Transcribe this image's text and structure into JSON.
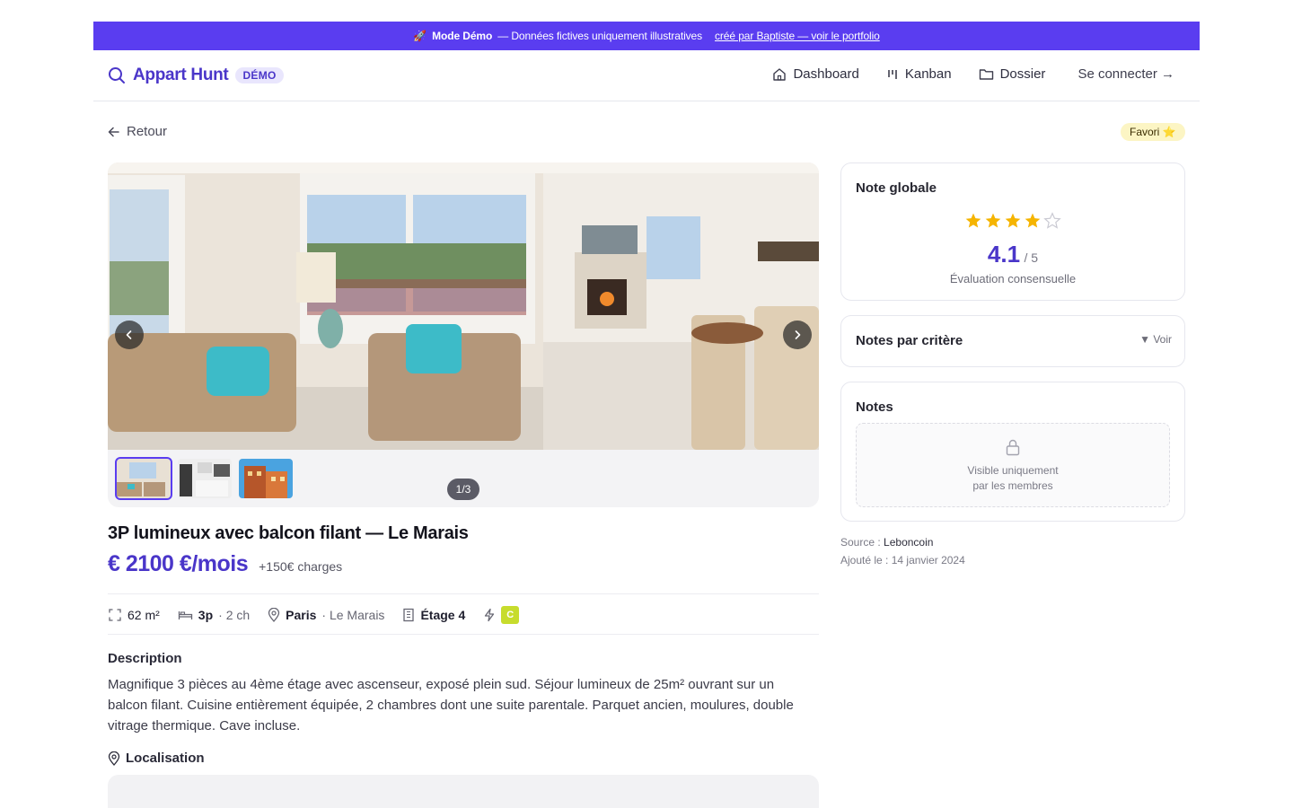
{
  "banner": {
    "icon": "rocket-icon",
    "mode_label": "Mode Démo",
    "text": "— Données fictives uniquement illustratives",
    "link": "créé par Baptiste — voir le portfolio"
  },
  "nav": {
    "brand": "Appart Hunt",
    "badge": "DÉMO",
    "links": [
      {
        "label": "Dashboard",
        "icon": "home-icon"
      },
      {
        "label": "Kanban",
        "icon": "kanban-icon"
      },
      {
        "label": "Dossier",
        "icon": "folder-icon"
      }
    ],
    "login": "Se connecter →"
  },
  "page": {
    "back": "Retour",
    "favorite": "Favori ⭐"
  },
  "gallery": {
    "counter": "1/3",
    "thumbnails": [
      "living-room",
      "kitchen",
      "building-facade"
    ]
  },
  "listing": {
    "title": "3P lumineux avec balcon filant — Le Marais",
    "price": "€ 2100 €/mois",
    "charges": "+150€ charges",
    "surface": "62 m²",
    "rooms": "3p",
    "bedrooms": "· 2 ch",
    "city": "Paris",
    "district": "· Le Marais",
    "floor": "Étage 4",
    "dpe": "C",
    "description_title": "Description",
    "description": "Magnifique 3 pièces au 4ème étage avec ascenseur, exposé plein sud. Séjour lumineux de 25m² ouvrant sur un balcon filant. Cuisine entièrement équipée, 2 chambres dont une suite parentale. Parquet ancien, moulures, double vitrage thermique. Cave incluse.",
    "location_title": "Localisation"
  },
  "rating": {
    "title": "Note globale",
    "value": "4.1",
    "out_of": "/ 5",
    "stars_filled": 4,
    "stars_total": 5,
    "caption": "Évaluation consensuelle"
  },
  "criteria": {
    "title": "Notes par critère",
    "toggle": "▼ Voir"
  },
  "notes": {
    "title": "Notes",
    "locked_line1": "Visible uniquement",
    "locked_line2": "par les membres"
  },
  "meta": {
    "source_label": "Source :",
    "source_value": "Leboncoin",
    "added_label": "Ajouté le :",
    "added_value": "14 janvier 2024"
  },
  "colors": {
    "accent": "#5a3df0",
    "brand": "#4a36c9",
    "star": "#f5b400",
    "dpe_c": "#c7dc2d"
  }
}
